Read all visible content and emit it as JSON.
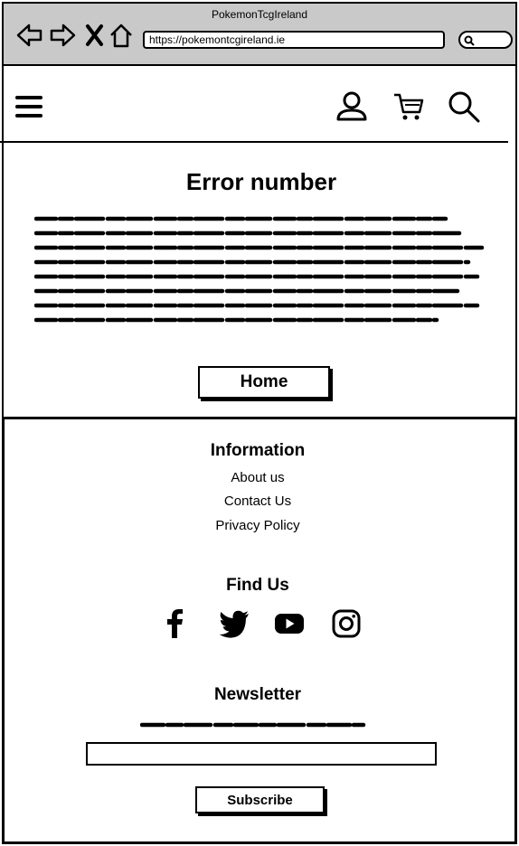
{
  "browser": {
    "title": "PokemonTcgIreland",
    "url": "https://pokemontcgireland.ie"
  },
  "main": {
    "error_title": "Error number",
    "home_button": "Home"
  },
  "footer": {
    "information_heading": "Information",
    "links": [
      "About us",
      "Contact Us",
      "Privacy Policy"
    ],
    "find_us_heading": "Find Us",
    "social_icons": [
      "facebook-icon",
      "twitter-icon",
      "youtube-icon",
      "instagram-icon"
    ],
    "newsletter_heading": "Newsletter",
    "newsletter_input_value": "",
    "subscribe_button": "Subscribe"
  },
  "icons": {
    "header": [
      "menu-icon",
      "user-icon",
      "cart-icon",
      "search-icon"
    ]
  }
}
